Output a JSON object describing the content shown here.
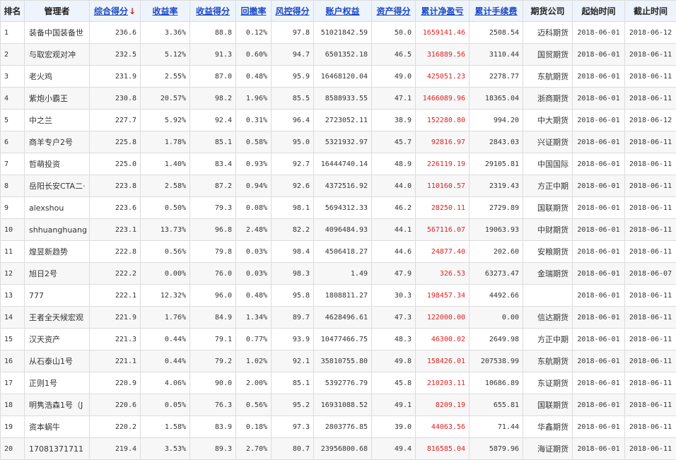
{
  "headers": {
    "rank": "排名",
    "manager": "管理者",
    "score": "综合得分",
    "return_rate": "收益率",
    "return_score": "收益得分",
    "drawdown": "回撤率",
    "risk_score": "风控得分",
    "equity": "账户权益",
    "asset_score": "资产得分",
    "cum_pnl": "累计净盈亏",
    "cum_fee": "累计手续费",
    "broker": "期货公司",
    "start": "起始时间",
    "end": "截止时间"
  },
  "sort_indicator": "↓",
  "colors": {
    "link": "#1a47c6",
    "profit": "#e02020",
    "header_bg": "#eef4fb"
  },
  "rows": [
    {
      "rank": "1",
      "manager": "装备中国装备世",
      "score": "236.6",
      "return_rate": "3.36%",
      "return_score": "88.8",
      "drawdown": "0.12%",
      "risk_score": "97.8",
      "equity": "51021842.59",
      "asset_score": "50.0",
      "cum_pnl": "1659141.46",
      "cum_fee": "2508.54",
      "broker": "迈科期货",
      "start": "2018-06-01",
      "end": "2018-06-12"
    },
    {
      "rank": "2",
      "manager": "与取宏观对冲",
      "score": "232.5",
      "return_rate": "5.12%",
      "return_score": "91.3",
      "drawdown": "0.60%",
      "risk_score": "94.7",
      "equity": "6501352.18",
      "asset_score": "46.5",
      "cum_pnl": "316889.56",
      "cum_fee": "3110.44",
      "broker": "国贸期货",
      "start": "2018-06-01",
      "end": "2018-06-11"
    },
    {
      "rank": "3",
      "manager": "老火鸡",
      "score": "231.9",
      "return_rate": "2.55%",
      "return_score": "87.0",
      "drawdown": "0.48%",
      "risk_score": "95.9",
      "equity": "16468120.04",
      "asset_score": "49.0",
      "cum_pnl": "425051.23",
      "cum_fee": "2278.77",
      "broker": "东航期货",
      "start": "2018-06-01",
      "end": "2018-06-11"
    },
    {
      "rank": "4",
      "manager": "紫炮小霸王",
      "score": "230.8",
      "return_rate": "20.57%",
      "return_score": "98.2",
      "drawdown": "1.96%",
      "risk_score": "85.5",
      "equity": "8588933.55",
      "asset_score": "47.1",
      "cum_pnl": "1466089.96",
      "cum_fee": "18365.04",
      "broker": "浙商期货",
      "start": "2018-06-01",
      "end": "2018-06-11"
    },
    {
      "rank": "5",
      "manager": "中之兰",
      "score": "227.7",
      "return_rate": "5.92%",
      "return_score": "92.4",
      "drawdown": "0.31%",
      "risk_score": "96.4",
      "equity": "2723052.11",
      "asset_score": "38.9",
      "cum_pnl": "152280.80",
      "cum_fee": "994.20",
      "broker": "中大期货",
      "start": "2018-06-01",
      "end": "2018-06-12"
    },
    {
      "rank": "6",
      "manager": "商羊专户2号",
      "score": "225.8",
      "return_rate": "1.78%",
      "return_score": "85.1",
      "drawdown": "0.58%",
      "risk_score": "95.0",
      "equity": "5321932.97",
      "asset_score": "45.7",
      "cum_pnl": "92816.97",
      "cum_fee": "2843.03",
      "broker": "兴证期货",
      "start": "2018-06-01",
      "end": "2018-06-11"
    },
    {
      "rank": "7",
      "manager": "哲萌投资",
      "score": "225.0",
      "return_rate": "1.40%",
      "return_score": "83.4",
      "drawdown": "0.93%",
      "risk_score": "92.7",
      "equity": "16444740.14",
      "asset_score": "48.9",
      "cum_pnl": "226119.19",
      "cum_fee": "29105.81",
      "broker": "中国国际",
      "start": "2018-06-01",
      "end": "2018-06-11"
    },
    {
      "rank": "8",
      "manager": "岳阳长安CTA二·",
      "score": "223.8",
      "return_rate": "2.58%",
      "return_score": "87.2",
      "drawdown": "0.94%",
      "risk_score": "92.6",
      "equity": "4372516.92",
      "asset_score": "44.0",
      "cum_pnl": "110160.57",
      "cum_fee": "2319.43",
      "broker": "方正中期",
      "start": "2018-06-01",
      "end": "2018-06-11"
    },
    {
      "rank": "9",
      "manager": "alexshou",
      "score": "223.6",
      "return_rate": "0.50%",
      "return_score": "79.3",
      "drawdown": "0.08%",
      "risk_score": "98.1",
      "equity": "5694312.33",
      "asset_score": "46.2",
      "cum_pnl": "28250.11",
      "cum_fee": "2729.89",
      "broker": "国联期货",
      "start": "2018-06-01",
      "end": "2018-06-11"
    },
    {
      "rank": "10",
      "manager": "shhuanghuang",
      "score": "223.1",
      "return_rate": "13.73%",
      "return_score": "96.8",
      "drawdown": "2.48%",
      "risk_score": "82.2",
      "equity": "4096484.93",
      "asset_score": "44.1",
      "cum_pnl": "567116.07",
      "cum_fee": "19063.93",
      "broker": "中财期货",
      "start": "2018-06-01",
      "end": "2018-06-11"
    },
    {
      "rank": "11",
      "manager": "煌昱新趋势",
      "score": "222.8",
      "return_rate": "0.56%",
      "return_score": "79.8",
      "drawdown": "0.03%",
      "risk_score": "98.4",
      "equity": "4506418.27",
      "asset_score": "44.6",
      "cum_pnl": "24877.40",
      "cum_fee": "202.60",
      "broker": "安粮期货",
      "start": "2018-06-01",
      "end": "2018-06-11"
    },
    {
      "rank": "12",
      "manager": "旭日2号",
      "score": "222.2",
      "return_rate": "0.00%",
      "return_score": "76.0",
      "drawdown": "0.03%",
      "risk_score": "98.3",
      "equity": "1.49",
      "asset_score": "47.9",
      "cum_pnl": "326.53",
      "cum_fee": "63273.47",
      "broker": "金瑞期货",
      "start": "2018-06-01",
      "end": "2018-06-07"
    },
    {
      "rank": "13",
      "manager": "777",
      "score": "222.1",
      "return_rate": "12.32%",
      "return_score": "96.0",
      "drawdown": "0.48%",
      "risk_score": "95.8",
      "equity": "1808811.27",
      "asset_score": "30.3",
      "cum_pnl": "198457.34",
      "cum_fee": "4492.66",
      "broker": "",
      "start": "2018-06-01",
      "end": "2018-06-11"
    },
    {
      "rank": "14",
      "manager": "王者全天候宏观",
      "score": "221.9",
      "return_rate": "1.76%",
      "return_score": "84.9",
      "drawdown": "1.34%",
      "risk_score": "89.7",
      "equity": "4628496.61",
      "asset_score": "47.3",
      "cum_pnl": "122000.00",
      "cum_fee": "0.00",
      "broker": "信达期货",
      "start": "2018-06-01",
      "end": "2018-06-11"
    },
    {
      "rank": "15",
      "manager": "汉天资产",
      "score": "221.3",
      "return_rate": "0.44%",
      "return_score": "79.1",
      "drawdown": "0.77%",
      "risk_score": "93.9",
      "equity": "10477466.75",
      "asset_score": "48.3",
      "cum_pnl": "46300.02",
      "cum_fee": "2649.98",
      "broker": "方正中期",
      "start": "2018-06-01",
      "end": "2018-06-11"
    },
    {
      "rank": "16",
      "manager": "从石泰山1号",
      "score": "221.1",
      "return_rate": "0.44%",
      "return_score": "79.2",
      "drawdown": "1.02%",
      "risk_score": "92.1",
      "equity": "35810755.80",
      "asset_score": "49.8",
      "cum_pnl": "158426.01",
      "cum_fee": "207538.99",
      "broker": "东航期货",
      "start": "2018-06-01",
      "end": "2018-06-11"
    },
    {
      "rank": "17",
      "manager": "正则1号",
      "score": "220.9",
      "return_rate": "4.06%",
      "return_score": "90.0",
      "drawdown": "2.00%",
      "risk_score": "85.1",
      "equity": "5392776.79",
      "asset_score": "45.8",
      "cum_pnl": "210203.11",
      "cum_fee": "10686.89",
      "broker": "东证期货",
      "start": "2018-06-01",
      "end": "2018-06-11"
    },
    {
      "rank": "18",
      "manager": "明隽浩森1号（J",
      "score": "220.6",
      "return_rate": "0.05%",
      "return_score": "76.3",
      "drawdown": "0.56%",
      "risk_score": "95.2",
      "equity": "16931088.52",
      "asset_score": "49.1",
      "cum_pnl": "8209.19",
      "cum_fee": "655.81",
      "broker": "国联期货",
      "start": "2018-06-01",
      "end": "2018-06-11"
    },
    {
      "rank": "19",
      "manager": "资本蜗牛",
      "score": "220.2",
      "return_rate": "1.58%",
      "return_score": "83.9",
      "drawdown": "0.18%",
      "risk_score": "97.3",
      "equity": "2803776.85",
      "asset_score": "39.0",
      "cum_pnl": "44063.56",
      "cum_fee": "71.44",
      "broker": "华鑫期货",
      "start": "2018-06-01",
      "end": "2018-06-11"
    },
    {
      "rank": "20",
      "manager": "17081371711",
      "score": "219.4",
      "return_rate": "3.53%",
      "return_score": "89.3",
      "drawdown": "2.70%",
      "risk_score": "80.7",
      "equity": "23956800.68",
      "asset_score": "49.4",
      "cum_pnl": "816585.04",
      "cum_fee": "5879.96",
      "broker": "海证期货",
      "start": "2018-06-01",
      "end": "2018-06-11"
    }
  ]
}
